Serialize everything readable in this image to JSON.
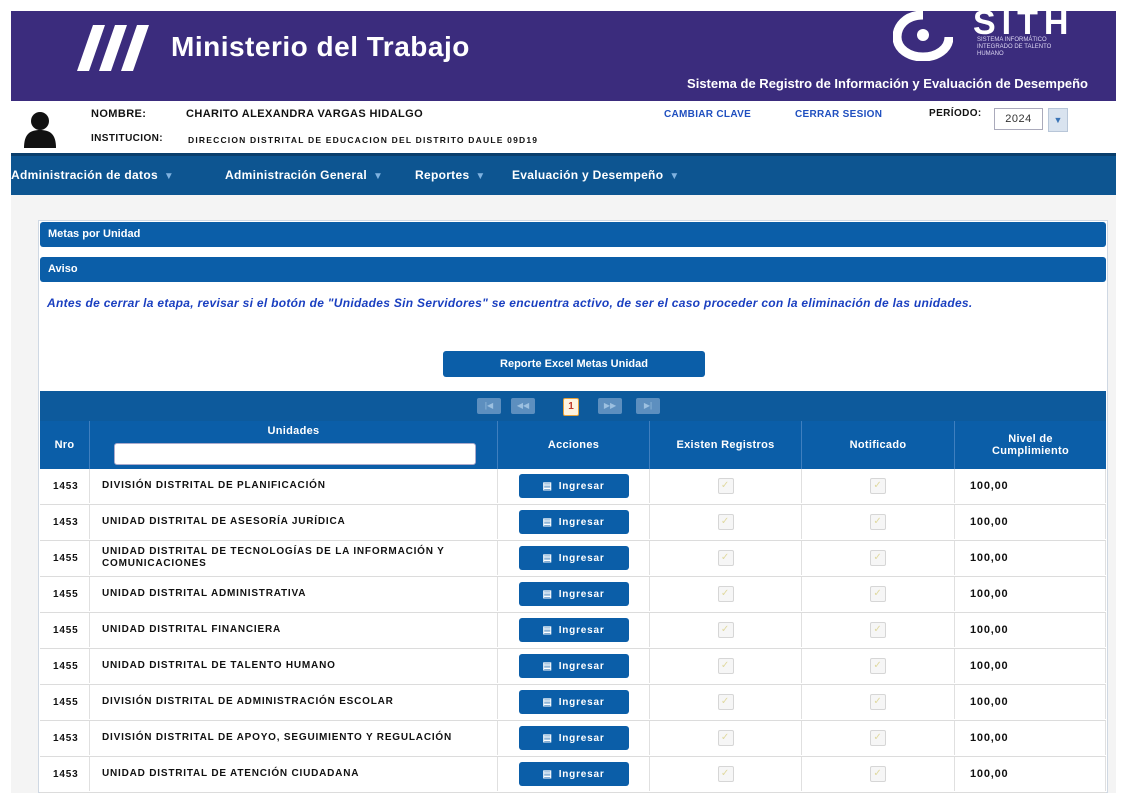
{
  "header": {
    "ministry": "Ministerio del Trabajo",
    "brand": "SITH",
    "brand_sub": "SISTEMA INFORMÁTICO INTEGRADO DE TALENTO HUMANO",
    "subtitle": "Sistema de Registro de Información y Evaluación de Desempeño"
  },
  "user": {
    "nombre_label": "NOMBRE:",
    "nombre_value": "CHARITO ALEXANDRA VARGAS HIDALGO",
    "institucion_label": "INSTITUCION:",
    "institucion_value": "DIRECCION DISTRITAL DE EDUCACION DEL DISTRITO DAULE 09D19",
    "change_password": "CAMBIAR CLAVE",
    "logout": "CERRAR SESION",
    "periodo_label": "PERÍODO:",
    "periodo_value": "2024"
  },
  "nav": [
    {
      "label": "Administración de datos"
    },
    {
      "label": "Administración General"
    },
    {
      "label": "Reportes"
    },
    {
      "label": "Evaluación y Desempeño"
    }
  ],
  "panel": {
    "title": "Metas por Unidad",
    "aviso_title": "Aviso",
    "aviso_text": "Antes de cerrar la etapa, revisar si el botón de \"Unidades Sin Servidores\" se encuentra activo, de ser el caso proceder con la eliminación de las unidades.",
    "report_button": "Reporte Excel Metas Unidad"
  },
  "pager": {
    "current_page": "1",
    "first": "|◀",
    "prev": "◀◀",
    "next": "▶▶",
    "last": "▶|"
  },
  "table": {
    "headers": {
      "nro": "Nro",
      "unidades": "Unidades",
      "acciones": "Acciones",
      "existen": "Existen Registros",
      "notificado": "Notificado",
      "nivel": "Nivel de Cumplimiento"
    },
    "action_label": "Ingresar",
    "rows": [
      {
        "nro": "1453",
        "unit": "DIVISIÓN DISTRITAL DE PLANIFICACIÓN",
        "nivel": "100,00"
      },
      {
        "nro": "1453",
        "unit": "UNIDAD DISTRITAL DE ASESORÍA JURÍDICA",
        "nivel": "100,00"
      },
      {
        "nro": "1455",
        "unit": "UNIDAD DISTRITAL DE TECNOLOGÍAS DE LA INFORMACIÓN Y COMUNICACIONES",
        "nivel": "100,00"
      },
      {
        "nro": "1455",
        "unit": "UNIDAD DISTRITAL ADMINISTRATIVA",
        "nivel": "100,00"
      },
      {
        "nro": "1455",
        "unit": "UNIDAD DISTRITAL FINANCIERA",
        "nivel": "100,00"
      },
      {
        "nro": "1455",
        "unit": "UNIDAD DISTRITAL DE TALENTO HUMANO",
        "nivel": "100,00"
      },
      {
        "nro": "1455",
        "unit": "DIVISIÓN DISTRITAL DE ADMINISTRACIÓN ESCOLAR",
        "nivel": "100,00"
      },
      {
        "nro": "1453",
        "unit": "DIVISIÓN DISTRITAL DE APOYO, SEGUIMIENTO Y REGULACIÓN",
        "nivel": "100,00"
      },
      {
        "nro": "1453",
        "unit": "UNIDAD DISTRITAL DE ATENCIÓN CIUDADANA",
        "nivel": "100,00"
      }
    ]
  },
  "colors": {
    "header": "#3b2c7d",
    "nav": "#0d5591",
    "primary": "#0b5ea8",
    "link": "#1f4fbf"
  }
}
